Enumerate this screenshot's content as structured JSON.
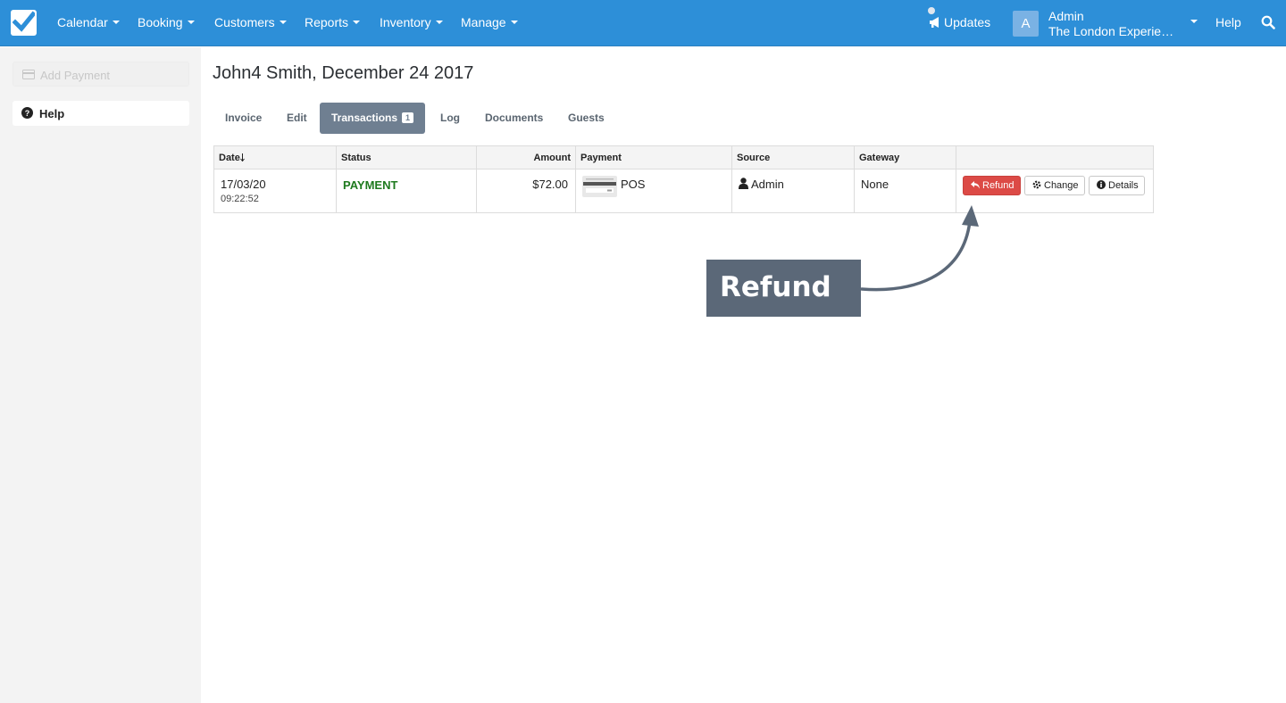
{
  "nav": {
    "items": [
      {
        "label": "Calendar"
      },
      {
        "label": "Booking"
      },
      {
        "label": "Customers"
      },
      {
        "label": "Reports"
      },
      {
        "label": "Inventory"
      },
      {
        "label": "Manage"
      }
    ],
    "updates_label": "Updates",
    "avatar_letter": "A",
    "user_name": "Admin",
    "user_org": "The London Experience...",
    "help_label": "Help",
    "brand_color": "#2d8fd8"
  },
  "sidebar": {
    "add_payment_label": "Add Payment",
    "help_label": "Help"
  },
  "page": {
    "title": "John4 Smith, December 24 2017"
  },
  "tabs": [
    {
      "label": "Invoice",
      "active": false
    },
    {
      "label": "Edit",
      "active": false
    },
    {
      "label": "Transactions",
      "active": true,
      "badge": "1"
    },
    {
      "label": "Log",
      "active": false
    },
    {
      "label": "Documents",
      "active": false
    },
    {
      "label": "Guests",
      "active": false
    }
  ],
  "table": {
    "headers": {
      "date": "Date",
      "status": "Status",
      "amount": "Amount",
      "payment": "Payment",
      "source": "Source",
      "gateway": "Gateway"
    },
    "rows": [
      {
        "date": "17/03/20",
        "time": "09:22:52",
        "status": "PAYMENT",
        "amount": "$72.00",
        "payment": "POS",
        "source": "Admin",
        "gateway": "None",
        "actions": {
          "refund": "Refund",
          "change": "Change",
          "details": "Details"
        }
      }
    ]
  },
  "callout": {
    "text": "Refund"
  },
  "colors": {
    "refund_button": "#dc4a46",
    "status_green": "#1e7a1e",
    "active_tab": "#6f7f91",
    "callout_bg": "#5b6878"
  }
}
